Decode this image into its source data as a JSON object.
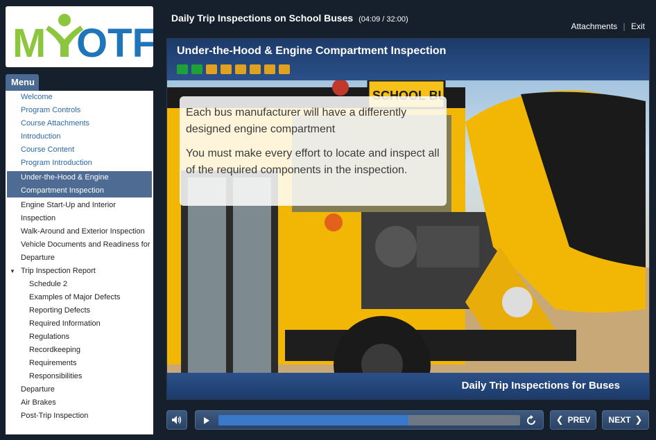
{
  "logo": {
    "text": "MYOTF",
    "colors": {
      "green": "#8cc63f",
      "blue": "#1f75b9"
    }
  },
  "menu": {
    "tab_label": "Menu",
    "items": [
      {
        "label": "Welcome",
        "style": "link"
      },
      {
        "label": "Program Controls",
        "style": "link"
      },
      {
        "label": "Course Attachments",
        "style": "link"
      },
      {
        "label": "Introduction",
        "style": "link"
      },
      {
        "label": "Course Content",
        "style": "link"
      },
      {
        "label": "Program Introduction",
        "style": "link"
      },
      {
        "label": "Under-the-Hood & Engine Compartment Inspection",
        "style": "active"
      },
      {
        "label": "Engine Start-Up and Interior Inspection",
        "style": "normal"
      },
      {
        "label": "Walk-Around and Exterior Inspection",
        "style": "normal"
      },
      {
        "label": "Vehicle Documents and Readiness for Departure",
        "style": "normal"
      },
      {
        "label": "Trip Inspection Report",
        "style": "expanded"
      },
      {
        "label": "Schedule 2",
        "style": "sub"
      },
      {
        "label": "Examples of Major Defects",
        "style": "sub"
      },
      {
        "label": "Reporting Defects",
        "style": "sub"
      },
      {
        "label": "Required Information",
        "style": "sub"
      },
      {
        "label": "Regulations",
        "style": "sub"
      },
      {
        "label": "Recordkeeping",
        "style": "sub"
      },
      {
        "label": "Requirements",
        "style": "sub"
      },
      {
        "label": "Responsibilities",
        "style": "sub"
      },
      {
        "label": "Departure",
        "style": "normal"
      },
      {
        "label": "Air Brakes",
        "style": "normal"
      },
      {
        "label": "Post-Trip Inspection",
        "style": "normal"
      }
    ]
  },
  "header": {
    "title": "Daily Trip Inspections on School Buses",
    "time": "(04:09 / 32:00)",
    "attachments_label": "Attachments",
    "exit_label": "Exit"
  },
  "slide": {
    "title": "Under-the-Hood & Engine Compartment Inspection",
    "progress": {
      "done": 2,
      "total": 8
    },
    "paragraphs": [
      "Each bus manufacturer will have a differently designed engine compartment",
      "You must make every effort to locate and inspect all of the required components in the inspection."
    ],
    "footer": "Daily Trip Inspections for Buses",
    "bus_sign": "SCHOOL BUS"
  },
  "controls": {
    "prev_label": "PREV",
    "next_label": "NEXT",
    "playback_fraction": 0.63,
    "icons": [
      "speaker-icon",
      "play-icon",
      "replay-icon",
      "chevron-left-icon",
      "chevron-right-icon"
    ]
  }
}
